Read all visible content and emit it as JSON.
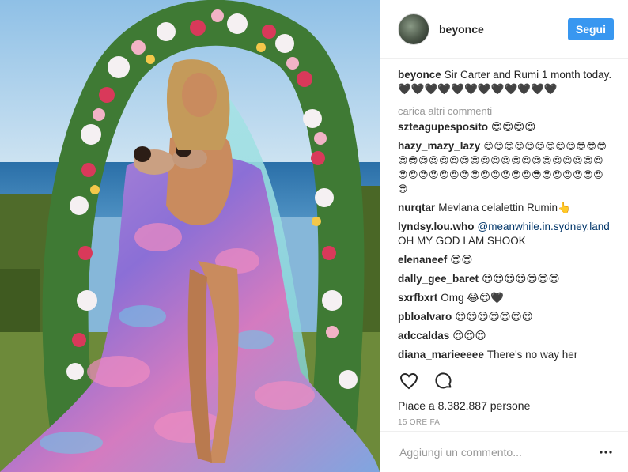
{
  "post": {
    "image_alt": "",
    "author": {
      "username": "beyonce"
    },
    "follow_label": "Segui",
    "caption": {
      "username": "beyonce",
      "text": "Sir Carter and Rumi 1 month today. 🖤🖤🖤🖤🖤🖤🖤🖤🖤🖤🖤🖤"
    },
    "load_more_label": "carica altri commenti",
    "comments": [
      {
        "username": "szteagupesposito",
        "text": "😍😍😍😍"
      },
      {
        "username": "hazy_mazy_lazy",
        "text": "😍😍😍😍😍😍😍😍😍😎😎😎😍😎😍😍😍😍😍😍😍😍😍😍😍😍😍😍😍😍😍😍😍😍😍😍😍😍😍😍😍😍😍😍😍😎😍😍😍😍😍😍😎"
      },
      {
        "username": "nurqtar",
        "text": "Mevlana celalettin Rumin👆"
      },
      {
        "username": "lyndsy.lou.who",
        "mention": "@meanwhile.in.sydney.land",
        "text": "OH MY GOD I AM SHOOK"
      },
      {
        "username": "elenaneef",
        "text": "😍😍"
      },
      {
        "username": "dally_gee_baret",
        "text": "😍😍😍😍😍😍😍"
      },
      {
        "username": "sxrfbxrt",
        "text": "Omg 😂😍🖤"
      },
      {
        "username": "pbloalvaro",
        "text": "😍😍😍😍😍😍😍"
      },
      {
        "username": "adccaldas",
        "text": "😍😍😍"
      },
      {
        "username": "diana_marieeeee",
        "text": "There's no way her"
      }
    ],
    "likes_text": "Piace a 8.382.887 persone",
    "timestamp": "15 ORE FA",
    "add_comment_placeholder": "Aggiungi un commento...",
    "colors": {
      "accent": "#3897f0",
      "text": "#262626",
      "muted": "#999999"
    }
  }
}
